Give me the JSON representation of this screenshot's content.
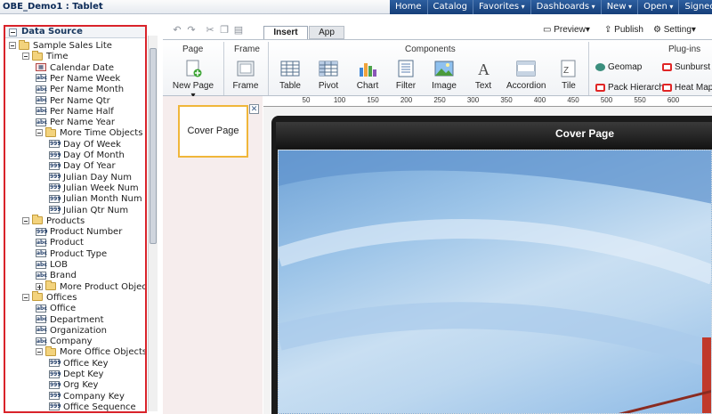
{
  "app_title": "OBE_Demo1 : Tablet",
  "global_nav": [
    {
      "label": "Home",
      "menu": false
    },
    {
      "label": "Catalog",
      "menu": false
    },
    {
      "label": "Favorites",
      "menu": true
    },
    {
      "label": "Dashboards",
      "menu": true
    },
    {
      "label": "New",
      "menu": true
    },
    {
      "label": "Open",
      "menu": true
    },
    {
      "label": "Signed In",
      "menu": false
    }
  ],
  "data_source": {
    "title": "Data Source",
    "tree": [
      {
        "label": "Sample Sales Lite",
        "type": "folder",
        "level": 0,
        "toggle": "minus"
      },
      {
        "label": "Time",
        "type": "folder",
        "level": 1,
        "toggle": "minus"
      },
      {
        "label": "Calendar Date",
        "type": "calendar",
        "level": 2
      },
      {
        "label": "Per Name Week",
        "type": "abc",
        "level": 2
      },
      {
        "label": "Per Name Month",
        "type": "abc",
        "level": 2
      },
      {
        "label": "Per Name Qtr",
        "type": "abc",
        "level": 2
      },
      {
        "label": "Per Name Half",
        "type": "abc",
        "level": 2
      },
      {
        "label": "Per Name Year",
        "type": "abc",
        "level": 2
      },
      {
        "label": "More Time Objects",
        "type": "folder",
        "level": 2,
        "toggle": "minus"
      },
      {
        "label": "Day Of Week",
        "type": "num",
        "level": 3
      },
      {
        "label": "Day Of Month",
        "type": "num",
        "level": 3
      },
      {
        "label": "Day Of Year",
        "type": "num",
        "level": 3
      },
      {
        "label": "Julian Day Num",
        "type": "num",
        "level": 3
      },
      {
        "label": "Julian Week Num",
        "type": "num",
        "level": 3
      },
      {
        "label": "Julian Month Num",
        "type": "num",
        "level": 3
      },
      {
        "label": "Julian Qtr Num",
        "type": "num",
        "level": 3
      },
      {
        "label": "Products",
        "type": "folder",
        "level": 1,
        "toggle": "minus"
      },
      {
        "label": "Product Number",
        "type": "num",
        "level": 2
      },
      {
        "label": "Product",
        "type": "abc",
        "level": 2
      },
      {
        "label": "Product Type",
        "type": "abc",
        "level": 2
      },
      {
        "label": "LOB",
        "type": "abc",
        "level": 2
      },
      {
        "label": "Brand",
        "type": "abc",
        "level": 2
      },
      {
        "label": "More Product Objects",
        "type": "folder",
        "level": 2,
        "toggle": "plus"
      },
      {
        "label": "Offices",
        "type": "folder",
        "level": 1,
        "toggle": "minus"
      },
      {
        "label": "Office",
        "type": "abc",
        "level": 2
      },
      {
        "label": "Department",
        "type": "abc",
        "level": 2
      },
      {
        "label": "Organization",
        "type": "abc",
        "level": 2
      },
      {
        "label": "Company",
        "type": "abc",
        "level": 2
      },
      {
        "label": "More Office Objects",
        "type": "folder",
        "level": 2,
        "toggle": "minus"
      },
      {
        "label": "Office Key",
        "type": "num",
        "level": 3
      },
      {
        "label": "Dept Key",
        "type": "num",
        "level": 3
      },
      {
        "label": "Org Key",
        "type": "num",
        "level": 3
      },
      {
        "label": "Company Key",
        "type": "num",
        "level": 3
      },
      {
        "label": "Office Sequence",
        "type": "num",
        "level": 3
      }
    ]
  },
  "toolbar": {
    "tab_insert": "Insert",
    "tab_app": "App",
    "preview": "Preview",
    "publish": "Publish",
    "setting": "Setting"
  },
  "ribbon": {
    "page_group": "Page",
    "frame_group": "Frame",
    "components_group": "Components",
    "plugins_group": "Plug-ins",
    "new_page": "New Page",
    "frame": "Frame",
    "components": [
      "Table",
      "Pivot",
      "Chart",
      "Filter",
      "Image",
      "Text",
      "Accordion",
      "Tile"
    ],
    "plugins": [
      "Geomap",
      "Sunburst",
      "Pack Hierarchy",
      "Heat Map"
    ]
  },
  "ruler_ticks": [
    "50",
    "100",
    "150",
    "200",
    "250",
    "300",
    "350",
    "400",
    "450",
    "500",
    "550",
    "600"
  ],
  "thumbnail": {
    "label": "Cover Page",
    "close": "✕"
  },
  "canvas": {
    "page_title": "Cover Page"
  }
}
